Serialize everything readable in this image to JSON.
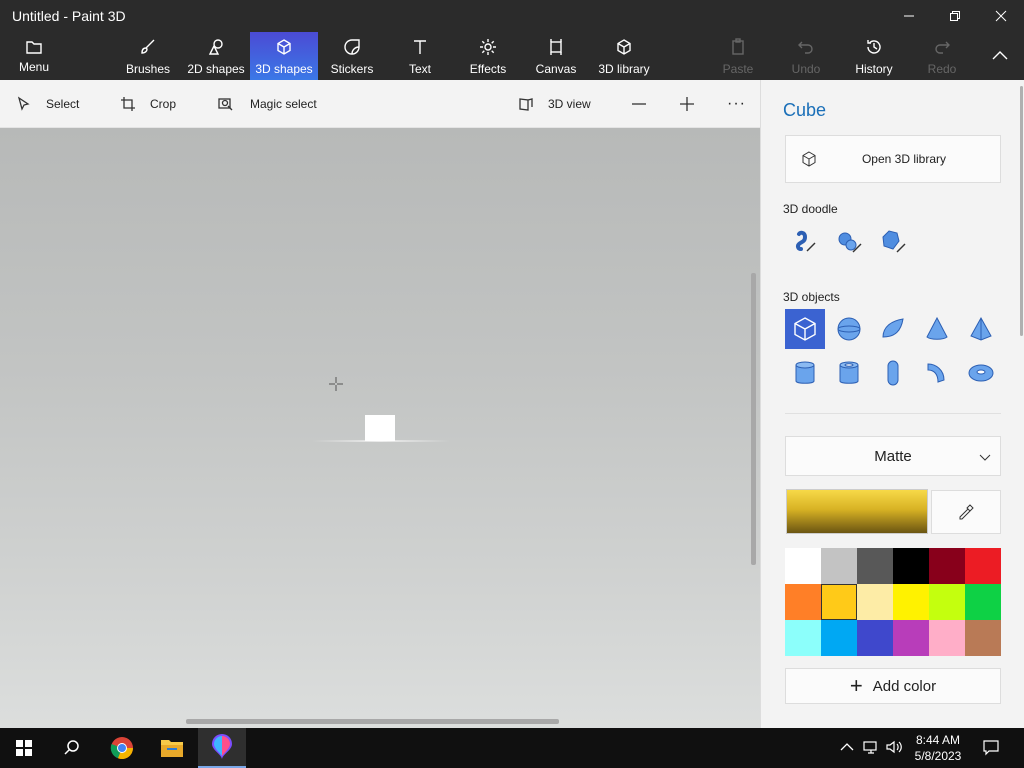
{
  "window": {
    "title": "Untitled - Paint 3D"
  },
  "ribbon": {
    "menu": "Menu",
    "brushes": "Brushes",
    "shapes2d": "2D shapes",
    "shapes3d": "3D shapes",
    "stickers": "Stickers",
    "text": "Text",
    "effects": "Effects",
    "canvas": "Canvas",
    "library3d": "3D library",
    "paste": "Paste",
    "undo": "Undo",
    "history": "History",
    "redo": "Redo"
  },
  "toolbar": {
    "select": "Select",
    "crop": "Crop",
    "magic_select": "Magic select",
    "view3d": "3D view",
    "more": "···"
  },
  "panel": {
    "title": "Cube",
    "open_library": "Open 3D library",
    "doodle_label": "3D doodle",
    "objects_label": "3D objects",
    "material": "Matte",
    "add_color": "Add color",
    "current_color": "#e8c22a",
    "palette": [
      "#ffffff",
      "#c3c3c3",
      "#585858",
      "#000000",
      "#88001b",
      "#ec1c24",
      "#ff7f27",
      "#ffca18",
      "#fdeca6",
      "#fff200",
      "#c4ff0e",
      "#0ed145",
      "#8cfffb",
      "#00a8f3",
      "#3f48cc",
      "#b83dba",
      "#ffaec8",
      "#b97a56"
    ],
    "selected_color_index": 7
  },
  "taskbar": {
    "time": "8:44 AM",
    "date": "5/8/2023"
  }
}
